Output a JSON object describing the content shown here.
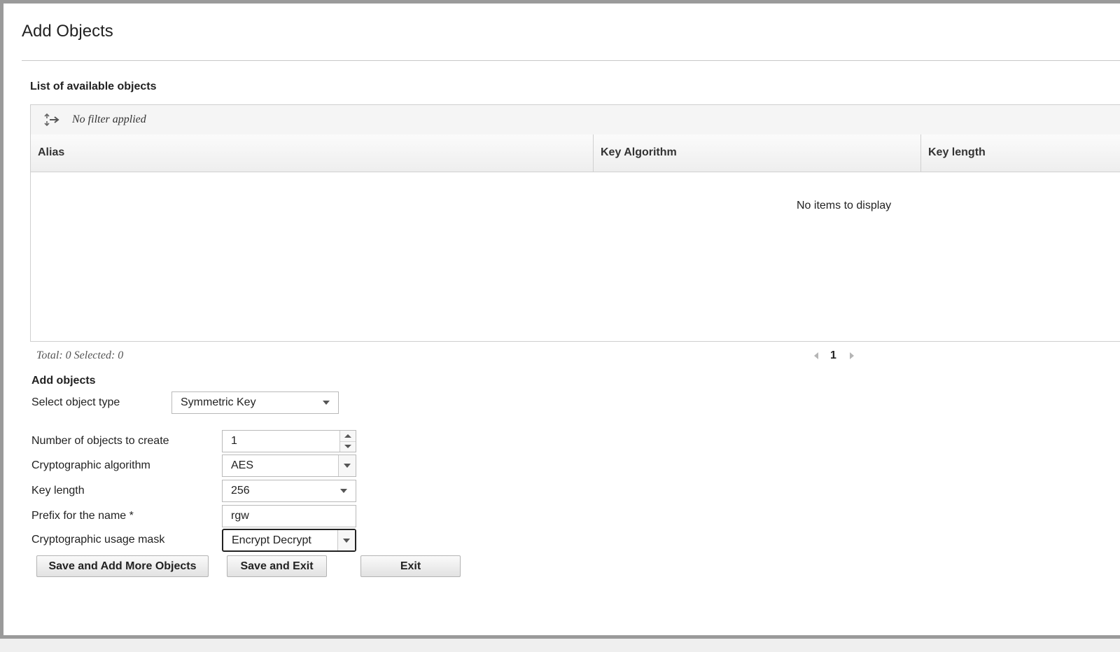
{
  "page": {
    "title": "Add Objects"
  },
  "objects_list": {
    "heading": "List of available objects",
    "filter_text": "No filter applied",
    "columns": [
      "Alias",
      "Key Algorithm",
      "Key length"
    ],
    "rows": [],
    "empty_message": "No items to display",
    "footer_summary": "Total: 0 Selected: 0",
    "current_page": "1"
  },
  "add_form": {
    "heading": "Add objects",
    "object_type": {
      "label": "Select object type",
      "value": "Symmetric Key"
    },
    "count": {
      "label": "Number of objects to create",
      "value": "1"
    },
    "algorithm": {
      "label": "Cryptographic algorithm",
      "value": "AES"
    },
    "key_length": {
      "label": "Key length",
      "value": "256"
    },
    "prefix": {
      "label": "Prefix for the name *",
      "value": "rgw"
    },
    "usage_mask": {
      "label": "Cryptographic usage mask",
      "value": "Encrypt Decrypt"
    }
  },
  "buttons": {
    "save_add_more": "Save and Add More Objects",
    "save_exit": "Save and Exit",
    "exit": "Exit"
  },
  "icons": {
    "filter": "filter-toggle-icon",
    "pager_prev": "chevron-left-icon",
    "pager_next": "chevron-right-icon",
    "dropdown": "chevron-down-icon"
  }
}
